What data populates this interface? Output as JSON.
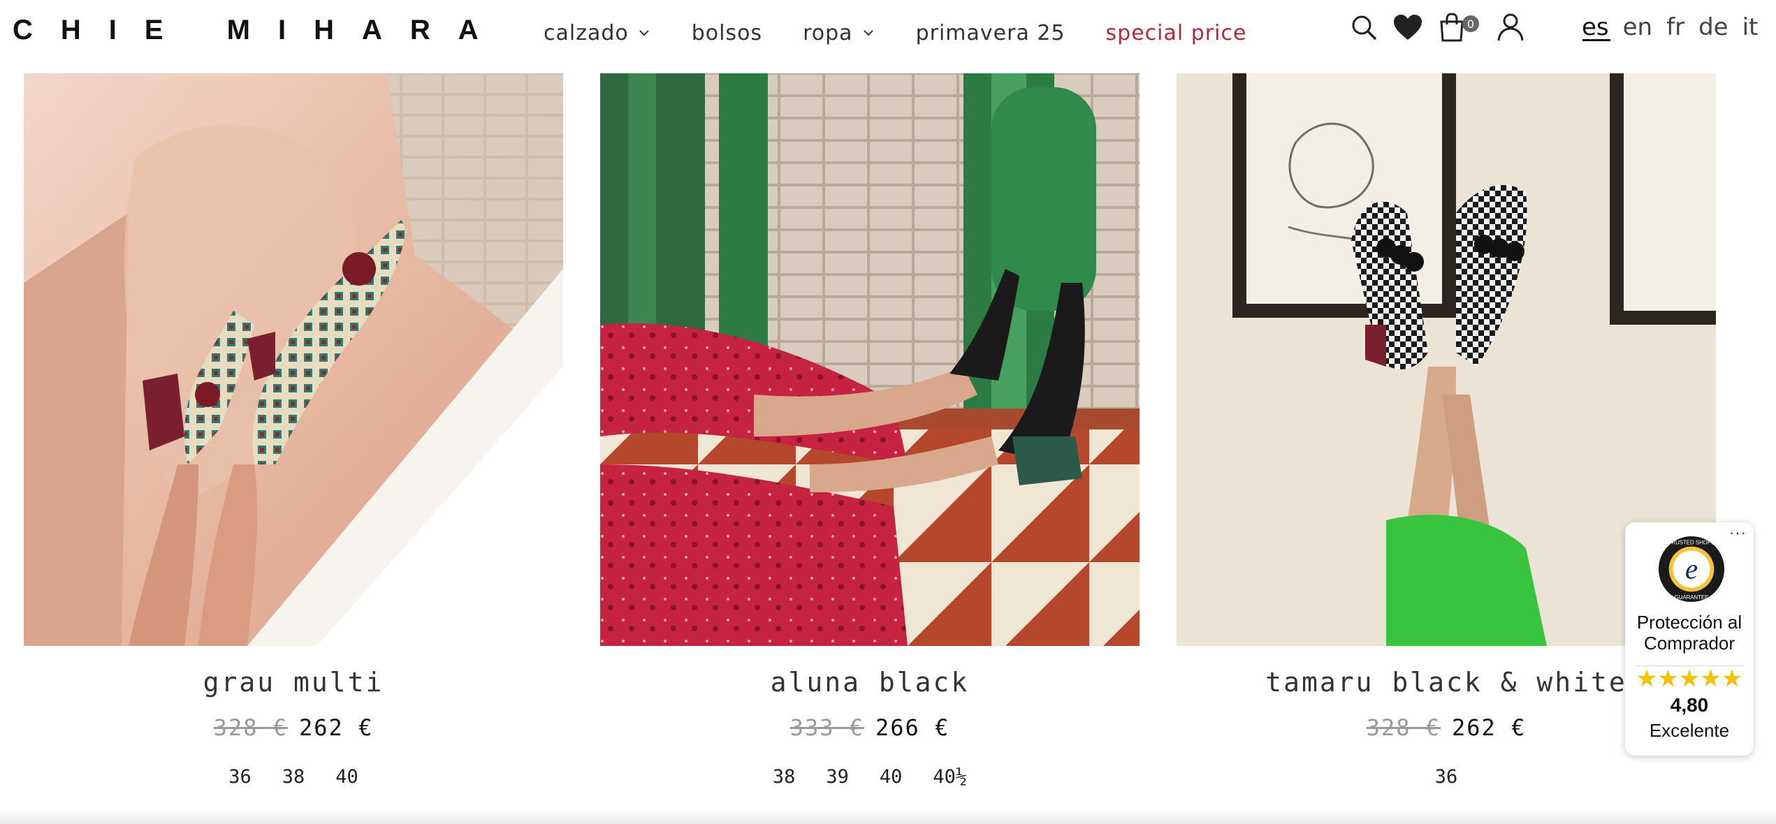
{
  "brand": {
    "name": "CHIE MIHARA"
  },
  "nav": {
    "items": [
      {
        "label": "calzado",
        "has_dropdown": true
      },
      {
        "label": "bolsos",
        "has_dropdown": false
      },
      {
        "label": "ropa",
        "has_dropdown": true
      },
      {
        "label": "primavera 25",
        "has_dropdown": false
      },
      {
        "label": "special price",
        "has_dropdown": false,
        "color": "#b12a3c"
      }
    ]
  },
  "header_icons": {
    "icons": [
      "search-icon",
      "heart-icon",
      "bag-icon",
      "user-icon"
    ],
    "cart_count": "0"
  },
  "languages": {
    "items": [
      "es",
      "en",
      "fr",
      "de",
      "it"
    ],
    "active": "es"
  },
  "products": [
    {
      "name": "grau multi",
      "old_price": "328 €",
      "price": "262 €",
      "sizes": [
        "36",
        "38",
        "40"
      ]
    },
    {
      "name": "aluna black",
      "old_price": "333 €",
      "price": "266 €",
      "sizes": [
        "38",
        "39",
        "40",
        "40½"
      ]
    },
    {
      "name": "tamaru black & white",
      "old_price": "328 €",
      "price": "262 €",
      "sizes": [
        "36"
      ]
    }
  ],
  "trusted_shops": {
    "menu": "···",
    "title": "Protección al Comprador",
    "stars": "★★★★★",
    "score": "4,80",
    "rating": "Excelente",
    "star_color": "#f2c200"
  }
}
